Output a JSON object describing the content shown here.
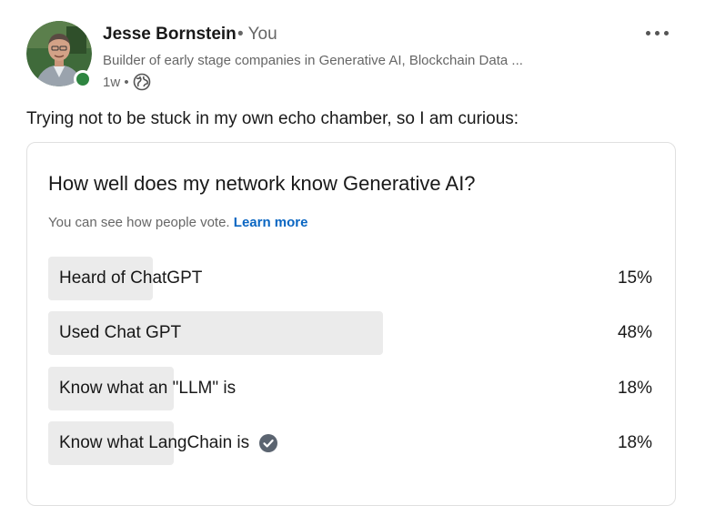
{
  "post": {
    "author": {
      "name": "Jesse Bornstein",
      "relation": "• You",
      "headline": "Builder of early stage companies in Generative AI, Blockchain Data ...",
      "timestamp": "1w •",
      "visibility_icon": "globe-icon",
      "online_status_color": "#2e8540"
    },
    "text": "Trying not to be stuck in my own echo chamber, so I am curious:",
    "more_icon": "ellipsis-icon"
  },
  "poll": {
    "question": "How well does my network know Generative AI?",
    "note": "You can see how people vote.",
    "learn_more": "Learn more",
    "options": [
      {
        "label": "Heard of ChatGPT",
        "percent": "15%",
        "value": 15,
        "selected": false
      },
      {
        "label": "Used Chat GPT",
        "percent": "48%",
        "value": 48,
        "selected": false
      },
      {
        "label": "Know what an \"LLM\" is",
        "percent": "18%",
        "value": 18,
        "selected": false
      },
      {
        "label": "Know what LangChain is",
        "percent": "18%",
        "value": 18,
        "selected": true
      }
    ],
    "selected_icon": "check-circle-icon",
    "colors": {
      "bar": "#ebebeb",
      "link": "#0a66c2"
    }
  }
}
